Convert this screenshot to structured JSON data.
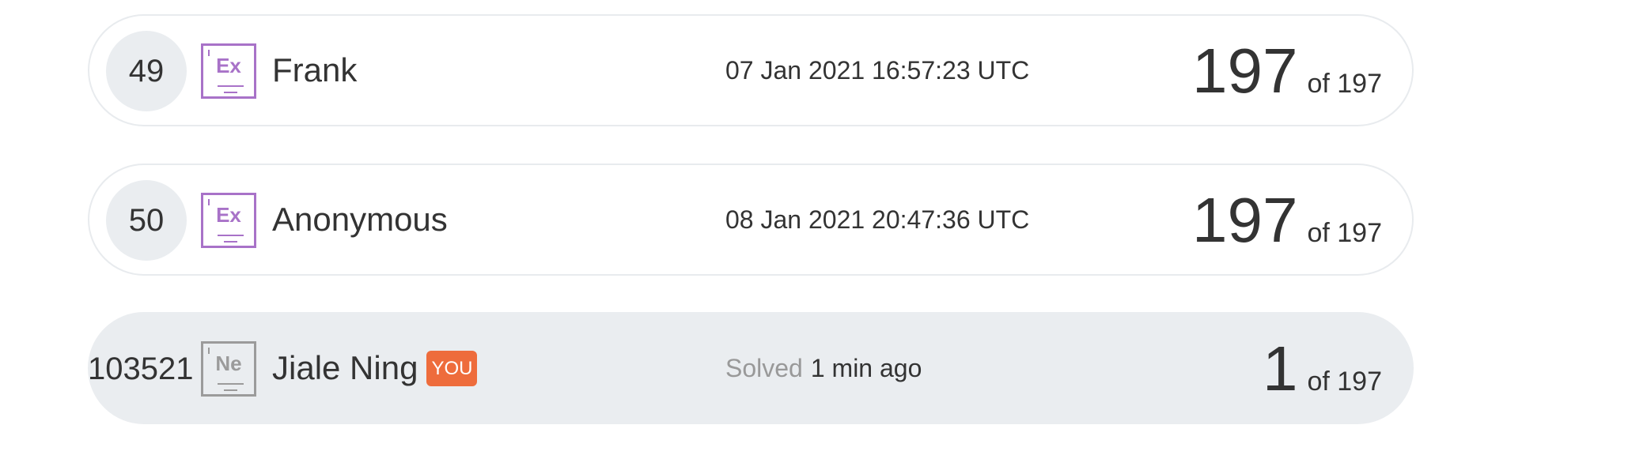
{
  "entries": [
    {
      "rank": "49",
      "badge_symbol": "Ex",
      "name": "Frank",
      "timestamp": "07 Jan 2021 16:57:23 UTC",
      "score": "197",
      "of_total": "of 197"
    },
    {
      "rank": "50",
      "badge_symbol": "Ex",
      "name": "Anonymous",
      "timestamp": "08 Jan 2021 20:47:36 UTC",
      "score": "197",
      "of_total": "of 197"
    }
  ],
  "current_user": {
    "rank": "103521",
    "badge_symbol": "Ne",
    "name": "Jiale Ning",
    "you_badge": "YOU",
    "solved_label": "Solved",
    "solved_time": "1 min ago",
    "score": "1",
    "of_total": "of 197"
  },
  "colors": {
    "badge_expert": "#a872c8",
    "badge_newbie": "#9b9b9b",
    "you_badge": "#ee6c3c",
    "row_highlight": "#eaedf0"
  }
}
